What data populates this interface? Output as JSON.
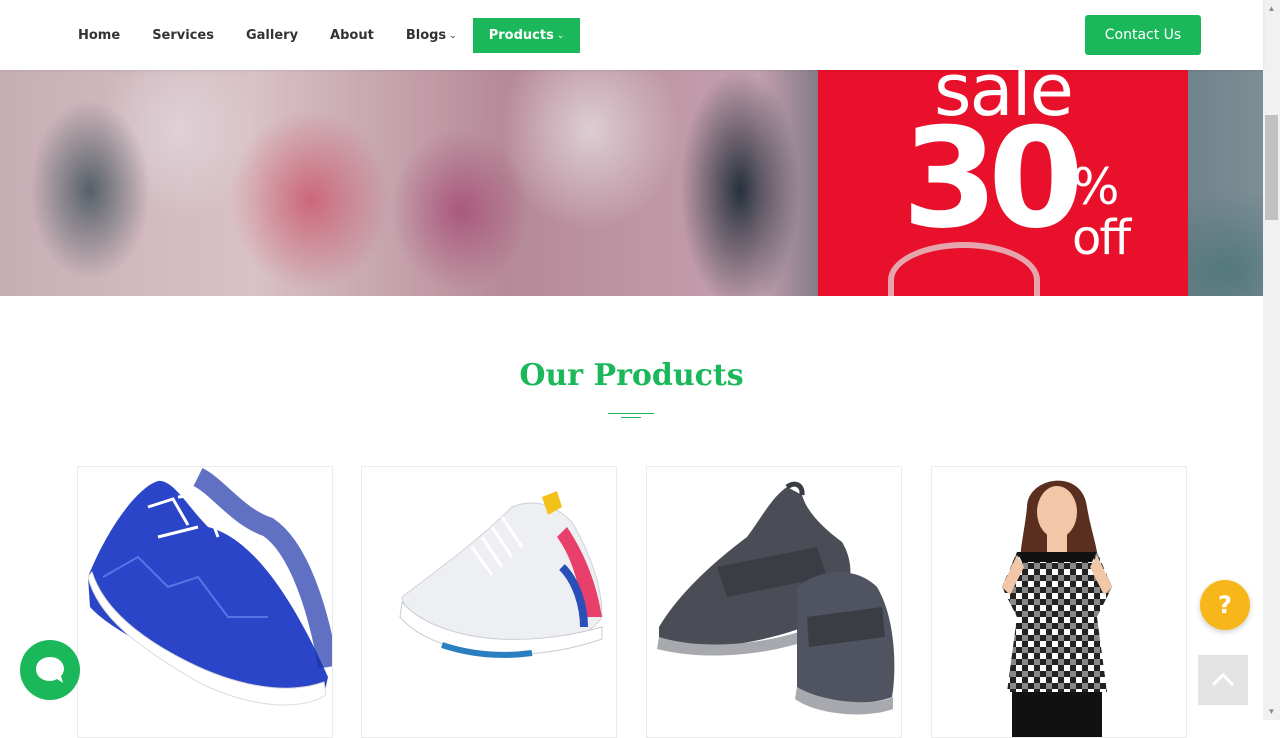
{
  "nav": {
    "items": [
      {
        "label": "Home"
      },
      {
        "label": "Services"
      },
      {
        "label": "Gallery"
      },
      {
        "label": "About"
      },
      {
        "label": "Blogs",
        "has_dropdown": true
      },
      {
        "label": "Products",
        "has_dropdown": true,
        "active": true
      }
    ],
    "contact_label": "Contact Us"
  },
  "hero": {
    "sale_word": "sale",
    "sale_number": "30",
    "sale_percent": "%",
    "sale_off": "off"
  },
  "products_section": {
    "title": "Our Products",
    "cards": [
      {
        "image": "blue-sneaker"
      },
      {
        "image": "white-running-shoe"
      },
      {
        "image": "grey-slip-on-shoe"
      },
      {
        "image": "checkered-cold-shoulder-top"
      }
    ]
  },
  "widgets": {
    "help_label": "?",
    "chat_icon": "chat-bubble-icon",
    "scroll_top_icon": "chevron-up-icon"
  },
  "colors": {
    "brand_green": "#1ab85a",
    "sale_red": "#e8102a",
    "help_yellow": "#f7b71a"
  }
}
